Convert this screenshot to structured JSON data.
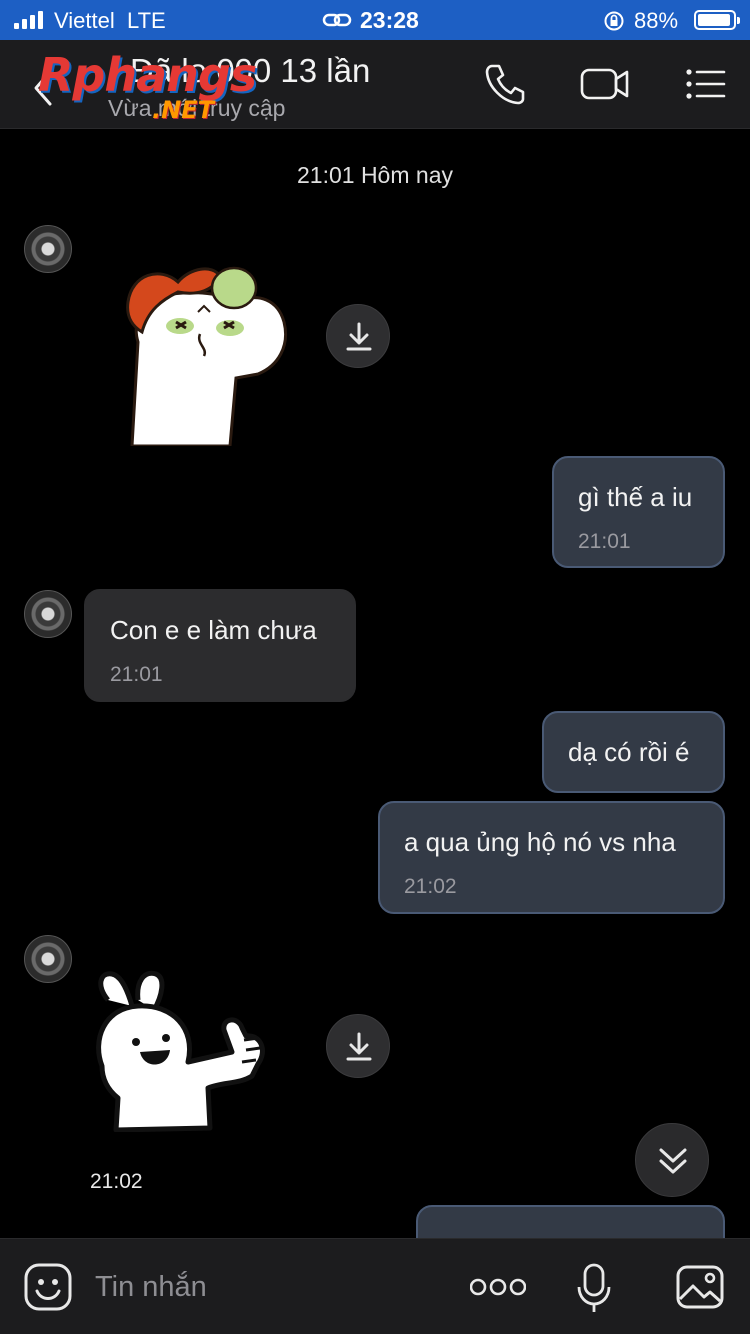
{
  "status_bar": {
    "carrier": "Viettel",
    "network": "LTE",
    "time": "23:28",
    "battery_percent": "88%"
  },
  "header": {
    "title": "Đã lo 000 13 lần",
    "subtitle": "Vừa mới truy cập",
    "watermark": "Rphangs",
    "watermark_suffix": ".NET",
    "icons": [
      "back-icon",
      "phone-icon",
      "video-icon",
      "menu-icon"
    ]
  },
  "chat": {
    "date_separator": "21:01 Hôm nay",
    "messages": [
      {
        "id": 1,
        "direction": "in",
        "type": "sticker",
        "sticker": "cat-with-bow"
      },
      {
        "id": 2,
        "direction": "out",
        "text": "gì thế a iu",
        "time": "21:01"
      },
      {
        "id": 3,
        "direction": "in",
        "text": "Con e e làm chưa",
        "time": "21:01"
      },
      {
        "id": 4,
        "direction": "out",
        "text": "dạ có rồi é"
      },
      {
        "id": 5,
        "direction": "out",
        "text": "a qua ủng hộ nó vs nha",
        "time": "21:02"
      },
      {
        "id": 6,
        "direction": "in",
        "type": "sticker",
        "sticker": "rabbit-thumbs-up",
        "time": "21:02"
      }
    ]
  },
  "composer": {
    "placeholder": "Tin nhắn"
  }
}
